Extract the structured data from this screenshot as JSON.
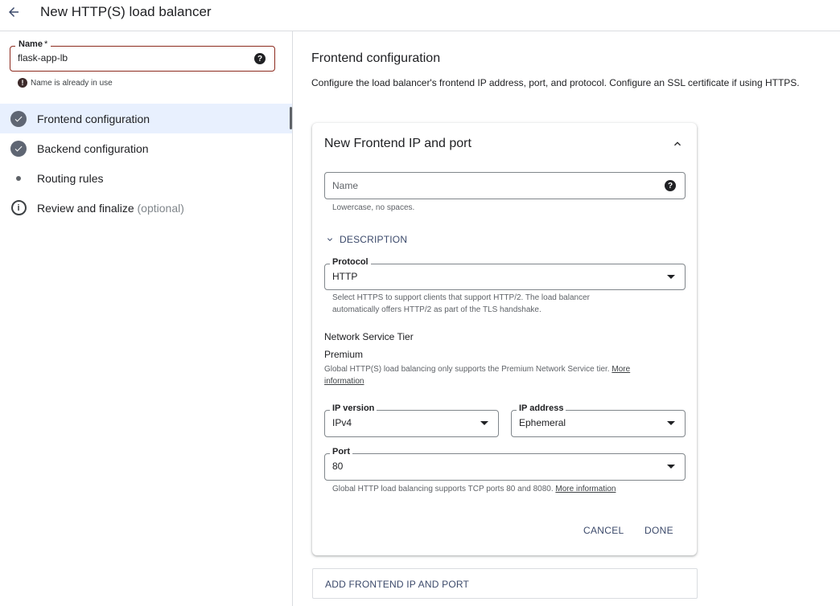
{
  "header": {
    "title": "New HTTP(S) load balancer"
  },
  "left": {
    "name_field": {
      "label": "Name",
      "required_mark": "*",
      "value": "flask-app-lb",
      "help_glyph": "?",
      "error": "Name is already in use",
      "error_glyph": "!"
    },
    "steps": [
      {
        "label": "Frontend configuration",
        "icon": "check-circle-icon",
        "active": true
      },
      {
        "label": "Backend configuration",
        "icon": "check-circle-icon",
        "active": false
      },
      {
        "label": "Routing rules",
        "icon": "dot-icon",
        "active": false
      },
      {
        "label": "Review and finalize",
        "optional": "(optional)",
        "icon": "info-icon",
        "info_glyph": "i",
        "active": false
      }
    ]
  },
  "main": {
    "title": "Frontend configuration",
    "description": "Configure the load balancer's frontend IP address, port, and protocol. Configure an SSL certificate if using HTTPS.",
    "card": {
      "title": "New Frontend IP and port",
      "name": {
        "placeholder": "Name",
        "help_glyph": "?",
        "hint": "Lowercase, no spaces."
      },
      "description_toggle": "DESCRIPTION",
      "protocol": {
        "label": "Protocol",
        "value": "HTTP",
        "hint_line1": "Select HTTPS to support clients that support HTTP/2. The load balancer",
        "hint_line2": "automatically offers HTTP/2 as part of the TLS handshake."
      },
      "network_tier": {
        "label": "Network Service Tier",
        "value": "Premium",
        "hint_prefix": "Global HTTP(S) load balancing only supports the Premium Network Service tier.",
        "link_part1": "More",
        "link_part2": "information"
      },
      "ip_version": {
        "label": "IP version",
        "value": "IPv4"
      },
      "ip_address": {
        "label": "IP address",
        "value": "Ephemeral"
      },
      "port": {
        "label": "Port",
        "value": "80",
        "hint_prefix": "Global HTTP load balancing supports TCP ports 80 and 8080.",
        "link": "More information"
      },
      "cancel_label": "CANCEL",
      "done_label": "DONE"
    },
    "add_button_label": "ADD FRONTEND IP AND PORT"
  },
  "colors": {
    "accent": "#3c4a6b",
    "error_border": "#8c2a1e",
    "active_step_bg": "#e8f0fe",
    "step_check": "#5f6673"
  }
}
